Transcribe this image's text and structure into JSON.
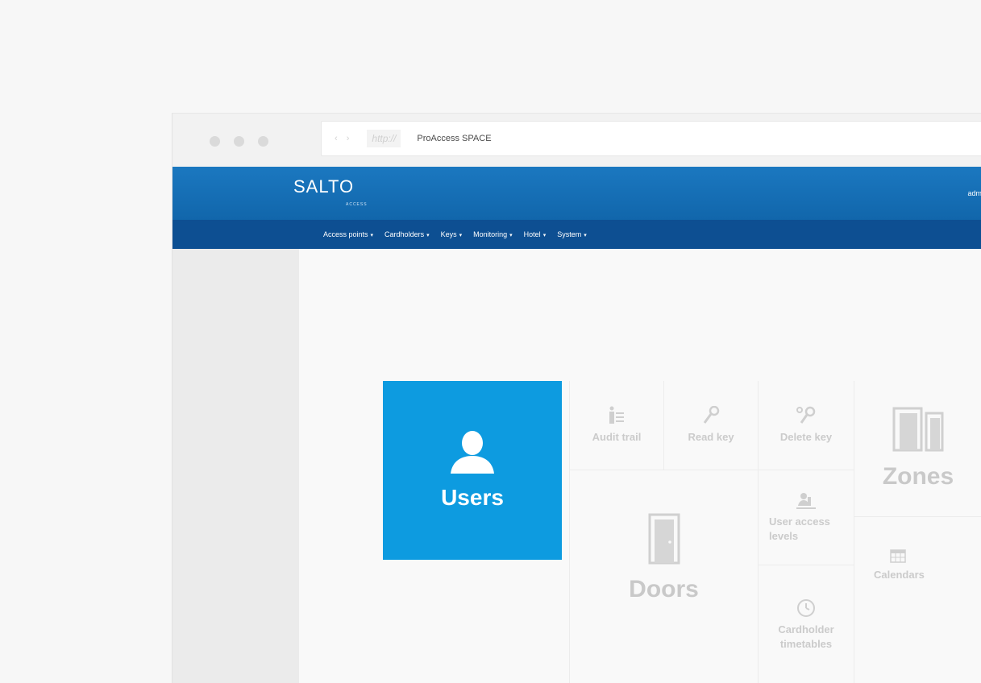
{
  "browser": {
    "nav_arrows": "‹ ›",
    "protocol": "http://",
    "title": "ProAccess SPACE"
  },
  "brand": {
    "logo": "SALTO",
    "logo_sub": "ACCESS",
    "user_corner": "adm"
  },
  "menu": {
    "items": [
      {
        "label": "Access points"
      },
      {
        "label": "Cardholders"
      },
      {
        "label": "Keys"
      },
      {
        "label": "Monitoring"
      },
      {
        "label": "Hotel"
      },
      {
        "label": "System"
      }
    ],
    "caret": "▾"
  },
  "tiles": {
    "users": "Users",
    "audit_trail": "Audit trail",
    "read_key": "Read key",
    "delete_key": "Delete key",
    "zones": "Zones",
    "doors": "Doors",
    "user_access_levels": "User access levels",
    "calendars": "Calendars",
    "cardholder_timetables": "Cardholder timetables"
  },
  "colors": {
    "brand_blue": "#1b78c0",
    "menu_blue": "#0d4f92",
    "users_tile": "#0d9be0",
    "inactive_text": "#c8c8c8"
  },
  "icons": {
    "users": "user-silhouette-icon",
    "audit_trail": "audit-trail-icon",
    "read_key": "key-icon",
    "delete_key": "delete-key-icon",
    "zones": "zones-doors-icon",
    "doors": "door-icon",
    "user_access_levels": "access-levels-icon",
    "calendars": "calendar-icon",
    "cardholder_timetables": "clock-icon"
  }
}
